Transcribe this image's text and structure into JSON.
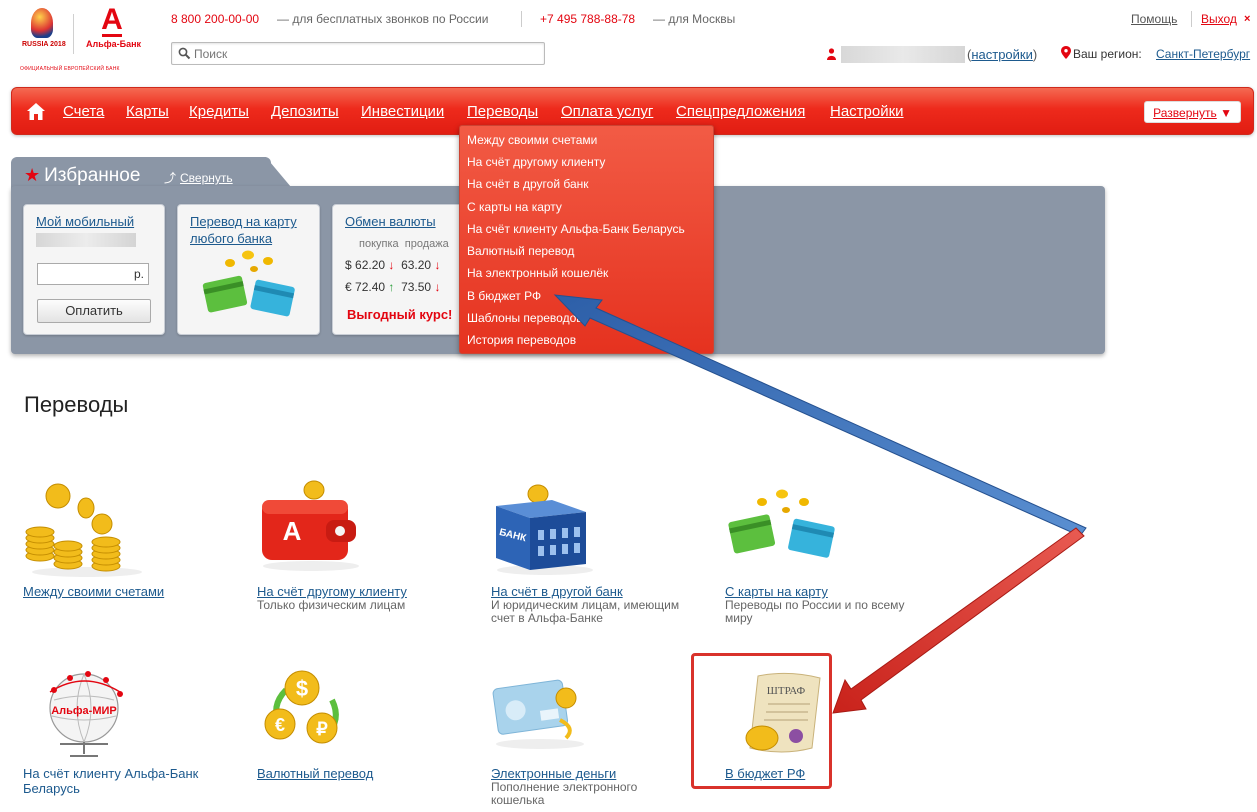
{
  "header": {
    "logo_wc_text": "RUSSIA 2018",
    "logo_bank_name": "Альфа-Банк",
    "official_text": "ОФИЦИАЛЬНЫЙ ЕВРОПЕЙСКИЙ БАНК",
    "phone_free": "8 800 200-00-00",
    "phone_free_note": "— для бесплатных звонков по России",
    "phone_moscow": "+7 495 788-88-78",
    "phone_moscow_note": "— для Москвы",
    "help": "Помощь",
    "logout": "Выход",
    "search_placeholder": "Поиск",
    "settings_link": "настройки",
    "region_label": "Ваш регион:",
    "region_value": "Санкт-Петербург"
  },
  "nav": {
    "items": [
      "Счета",
      "Карты",
      "Кредиты",
      "Депозиты",
      "Инвестиции",
      "Переводы",
      "Оплата услуг",
      "Спецпредложения",
      "Настройки"
    ],
    "expand": "Развернуть"
  },
  "favorites": {
    "title": "Избранное",
    "collapse": "Свернуть",
    "mobile": {
      "title": "Мой мобильный",
      "currency": "р.",
      "pay_button": "Оплатить"
    },
    "card_transfer": {
      "title_line1": "Перевод на карту",
      "title_line2": "любого банка"
    },
    "exchange": {
      "title": "Обмен валюты",
      "col_buy": "покупка",
      "col_sell": "продажа",
      "rows": [
        {
          "currency": "$",
          "buy": "62.20",
          "buy_trend": "↓",
          "sell": "63.20",
          "sell_trend": "↓"
        },
        {
          "currency": "€",
          "buy": "72.40",
          "buy_trend": "↑",
          "sell": "73.50",
          "sell_trend": "↓"
        }
      ],
      "best_rate": "Выгодный курс!"
    }
  },
  "dropdown": {
    "items": [
      "Между своими счетами",
      "На счёт другому клиенту",
      "На счёт в другой банк",
      "С карты на карту",
      "На счёт клиенту Альфа-Банк Беларусь",
      "Валютный перевод",
      "На электронный кошелёк",
      "В бюджет РФ",
      "Шаблоны переводов",
      "История переводов"
    ]
  },
  "transfers": {
    "title": "Переводы",
    "tiles": [
      {
        "title": "Между своими счетами",
        "sub": "",
        "icon": "coins-icon"
      },
      {
        "title": "На счёт другому клиенту",
        "sub": "Только физическим лицам",
        "icon": "wallet-icon"
      },
      {
        "title": "На счёт в другой банк",
        "sub": "И юридическим лицам, имеющим счет в Альфа-Банке",
        "icon": "bank-building-icon"
      },
      {
        "title": "С карты на карту",
        "sub": "Переводы по России и по всему миру",
        "icon": "cards-icon"
      },
      {
        "title": "На счёт клиенту Альфа-Банк Беларусь",
        "sub": "",
        "icon": "globe-icon"
      },
      {
        "title": "Валютный перевод",
        "sub": "",
        "icon": "currency-exchange-icon"
      },
      {
        "title": "Электронные деньги",
        "sub": "Пополнение электронного кошелька",
        "icon": "e-money-card-icon"
      },
      {
        "title": "В бюджет РФ",
        "sub": "",
        "icon": "fine-document-icon"
      }
    ],
    "globe_label": "Альфа-МИР",
    "bank_label": "БАНК",
    "fine_label": "ШТРАФ"
  },
  "colors": {
    "brand_red": "#e30611",
    "link_blue": "#1d5a8e",
    "panel_gray": "#8b96a6",
    "annotation_blue": "#3f74b8",
    "annotation_red": "#d9322b"
  }
}
